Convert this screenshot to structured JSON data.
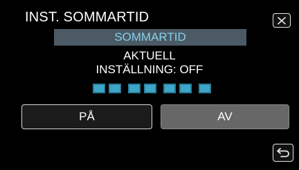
{
  "header": {
    "title": "INST. SOMMARTID",
    "close_icon": "close-icon"
  },
  "setting": {
    "label": "SOMMARTID"
  },
  "status": {
    "line1": "AKTUELL",
    "line2": "INSTÄLLNING: OFF"
  },
  "progress": {
    "filled_segments": 7,
    "total_segments": 7
  },
  "buttons": {
    "on_label": "PÅ",
    "off_label": "AV"
  },
  "footer": {
    "back_icon": "back-arrow-icon"
  },
  "colors": {
    "setting_text": "#86d1ea",
    "setting_bar": "#4b5a65",
    "progress": "#3ea7c9",
    "off_button": "#676767"
  }
}
